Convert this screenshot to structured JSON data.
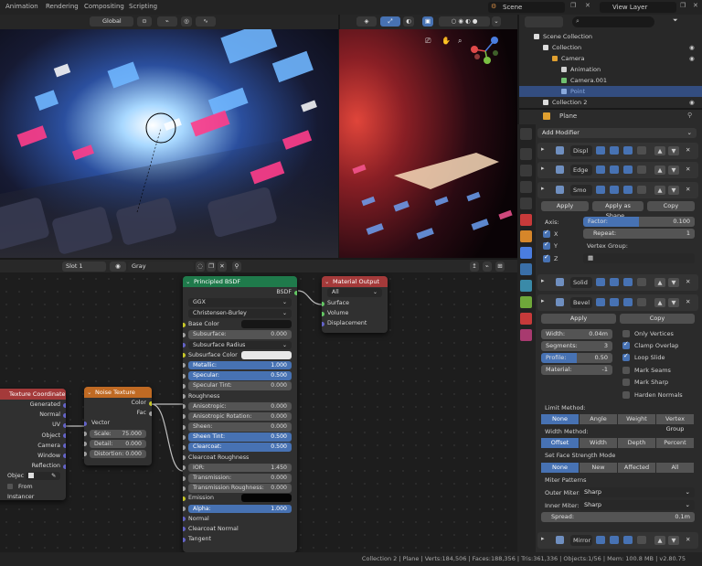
{
  "topbar": {
    "workspaces": [
      "Animation",
      "Rendering",
      "Compositing",
      "Scripting"
    ],
    "scene": "Scene",
    "view_layer": "View Layer"
  },
  "viewport_header": {
    "orientation": "Global"
  },
  "node_editor_header": {
    "slot": "Slot 1",
    "material": "Gray"
  },
  "nodes": {
    "principled": {
      "title": "Principled BSDF",
      "output": "BSDF",
      "distribution": "GGX",
      "subsurface_method": "Christensen-Burley",
      "rows": [
        {
          "label": "Base Color",
          "type": "color",
          "color": "#161616"
        },
        {
          "label": "Subsurface:",
          "value": "0.000"
        },
        {
          "label": "Subsurface Radius",
          "type": "dropdown"
        },
        {
          "label": "Subsurface Color",
          "type": "color",
          "color": "#e8e8e8"
        },
        {
          "label": "Metallic:",
          "value": "1.000",
          "blue": true
        },
        {
          "label": "Specular:",
          "value": "0.500",
          "blue": true
        },
        {
          "label": "Specular Tint:",
          "value": "0.000"
        },
        {
          "label": "Roughness",
          "type": "plain"
        },
        {
          "label": "Anisotropic:",
          "value": "0.000"
        },
        {
          "label": "Anisotropic Rotation:",
          "value": "0.000"
        },
        {
          "label": "Sheen:",
          "value": "0.000"
        },
        {
          "label": "Sheen Tint:",
          "value": "0.500",
          "blue": true
        },
        {
          "label": "Clearcoat:",
          "value": "0.500",
          "blue": true
        },
        {
          "label": "Clearcoat Roughness",
          "type": "plain"
        },
        {
          "label": "IOR:",
          "value": "1.450"
        },
        {
          "label": "Transmission:",
          "value": "0.000"
        },
        {
          "label": "Transmission Roughness:",
          "value": "0.000"
        },
        {
          "label": "Emission",
          "type": "color",
          "color": "#050505"
        },
        {
          "label": "Alpha:",
          "value": "1.000",
          "blue": true
        },
        {
          "label": "Normal",
          "type": "plain"
        },
        {
          "label": "Clearcoat Normal",
          "type": "plain"
        },
        {
          "label": "Tangent",
          "type": "plain"
        }
      ]
    },
    "material_output": {
      "title": "Material Output",
      "target": "All",
      "inputs": [
        "Surface",
        "Volume",
        "Displacement"
      ]
    },
    "noise": {
      "title": "Noise Texture",
      "outputs": [
        "Color",
        "Fac"
      ],
      "vector": "Vector",
      "scale_label": "Scale:",
      "scale": "75.000",
      "detail_label": "Detail:",
      "detail": "0.000",
      "distortion_label": "Distortion:",
      "distortion": "0.000"
    },
    "texcoord": {
      "title": "Texture Coordinate",
      "outputs": [
        "Generated",
        "Normal",
        "UV",
        "Object",
        "Camera",
        "Window",
        "Reflection"
      ],
      "object_label": "Objec",
      "from_instancer": "From Instancer"
    }
  },
  "outliner": {
    "rows": [
      {
        "label": "Scene Collection",
        "indent": 0
      },
      {
        "label": "Collection",
        "indent": 1
      },
      {
        "label": "Camera",
        "indent": 2
      },
      {
        "label": "Animation",
        "indent": 3
      },
      {
        "label": "Camera.001",
        "indent": 3
      },
      {
        "label": "Point",
        "indent": 3,
        "selected": true
      },
      {
        "label": "Collection 2",
        "indent": 1
      }
    ]
  },
  "properties": {
    "object_name": "Plane",
    "add_modifier": "Add Modifier",
    "modifiers": {
      "displace": "Displ",
      "edge": "Edge",
      "smooth": "Smo",
      "solid": "Solid",
      "bevel": "Bevel",
      "mirror": "Mirror"
    },
    "smooth": {
      "apply": "Apply",
      "apply_shape": "Apply as Shape...",
      "copy": "Copy",
      "axis": "Axis:",
      "factor_label": "Factor:",
      "factor": "0.100",
      "x": "X",
      "y": "Y",
      "z": "Z",
      "repeat_label": "Repeat:",
      "repeat": "1",
      "vertex_group": "Vertex Group:"
    },
    "bevel": {
      "apply": "Apply",
      "copy": "Copy",
      "width_label": "Width:",
      "width": "0.04m",
      "segments_label": "Segments:",
      "segments": "3",
      "profile_label": "Profile:",
      "profile": "0.50",
      "material_label": "Material:",
      "material": "-1",
      "only_vertices": "Only Vertices",
      "clamp_overlap": "Clamp Overlap",
      "loop_slide": "Loop Slide",
      "mark_seams": "Mark Seams",
      "mark_sharp": "Mark Sharp",
      "harden_normals": "Harden Normals",
      "limit_method": "Limit Method:",
      "limit_options": [
        "None",
        "Angle",
        "Weight",
        "Vertex Group"
      ],
      "width_method": "Width Method:",
      "width_options": [
        "Offset",
        "Width",
        "Depth",
        "Percent"
      ],
      "face_strength": "Set Face Strength Mode",
      "face_options": [
        "None",
        "New",
        "Affected",
        "All"
      ],
      "miter_patterns": "Miter Patterns",
      "outer_miter_label": "Outer Miter:",
      "outer_miter": "Sharp",
      "inner_miter_label": "Inner Miter:",
      "inner_miter": "Sharp",
      "spread_label": "Spread:",
      "spread": "0.1m"
    }
  },
  "statusbar": "Collection 2 | Plane | Verts:184,506 | Faces:188,356 | Tris:361,336 | Objects:1/56 | Mem: 100.8 MB | v2.80.75"
}
